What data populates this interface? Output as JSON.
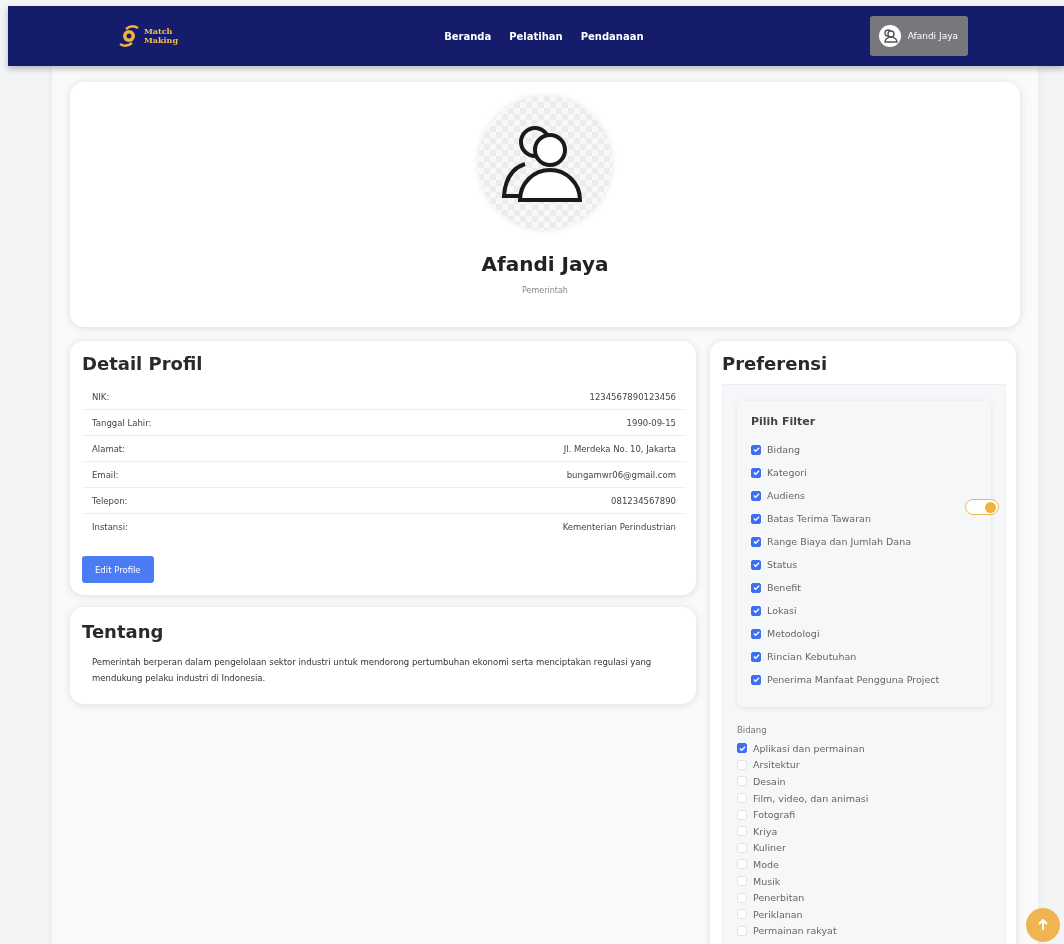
{
  "navbar": {
    "logo": [
      "Match",
      "Making"
    ],
    "links": [
      "Beranda",
      "Pelatihan",
      "Pendanaan"
    ],
    "user": "Afandi Jaya"
  },
  "profile": {
    "name": "Afandi Jaya",
    "role": "Pemerintah"
  },
  "detail": {
    "title": "Detail Profil",
    "rows": [
      {
        "label": "NIK:",
        "value": "1234567890123456"
      },
      {
        "label": "Tanggal Lahir:",
        "value": "1990-09-15"
      },
      {
        "label": "Alamat:",
        "value": "Jl. Merdeka No. 10, Jakarta"
      },
      {
        "label": "Email:",
        "value": "bungamwr06@gmail.com"
      },
      {
        "label": "Telepon:",
        "value": "081234567890"
      },
      {
        "label": "Instansi:",
        "value": "Kementerian Perindustrian"
      }
    ],
    "button": "Edit Profile"
  },
  "about": {
    "title": "Tentang",
    "text": "Pemerintah berperan dalam pengelolaan sektor industri untuk mendorong pertumbuhan ekonomi serta menciptakan regulasi yang mendukung pelaku industri di Indonesia."
  },
  "preferences": {
    "title": "Preferensi",
    "filter_title": "Pilih Filter",
    "filters": [
      {
        "label": "Bidang",
        "checked": true
      },
      {
        "label": "Kategori",
        "checked": true
      },
      {
        "label": "Audiens",
        "checked": true
      },
      {
        "label": "Batas Terima Tawaran",
        "checked": true
      },
      {
        "label": "Range Biaya dan Jumlah Dana",
        "checked": true
      },
      {
        "label": "Status",
        "checked": true
      },
      {
        "label": "Benefit",
        "checked": true
      },
      {
        "label": "Lokasi",
        "checked": true
      },
      {
        "label": "Metodologi",
        "checked": true
      },
      {
        "label": "Rincian Kebutuhan",
        "checked": true
      },
      {
        "label": "Penerima Manfaat Pengguna Project",
        "checked": true
      }
    ],
    "toggle_on": true,
    "group_title": "Bidang",
    "options": [
      {
        "label": "Aplikasi dan permainan",
        "checked": true
      },
      {
        "label": "Arsitektur",
        "checked": false
      },
      {
        "label": "Desain",
        "checked": false
      },
      {
        "label": "Film, video, dan animasi",
        "checked": false
      },
      {
        "label": "Fotografi",
        "checked": false
      },
      {
        "label": "Kriya",
        "checked": false
      },
      {
        "label": "Kuliner",
        "checked": false
      },
      {
        "label": "Mode",
        "checked": false
      },
      {
        "label": "Musik",
        "checked": false
      },
      {
        "label": "Penerbitan",
        "checked": false
      },
      {
        "label": "Periklanan",
        "checked": false
      },
      {
        "label": "Permainan rakyat",
        "checked": false
      }
    ]
  }
}
